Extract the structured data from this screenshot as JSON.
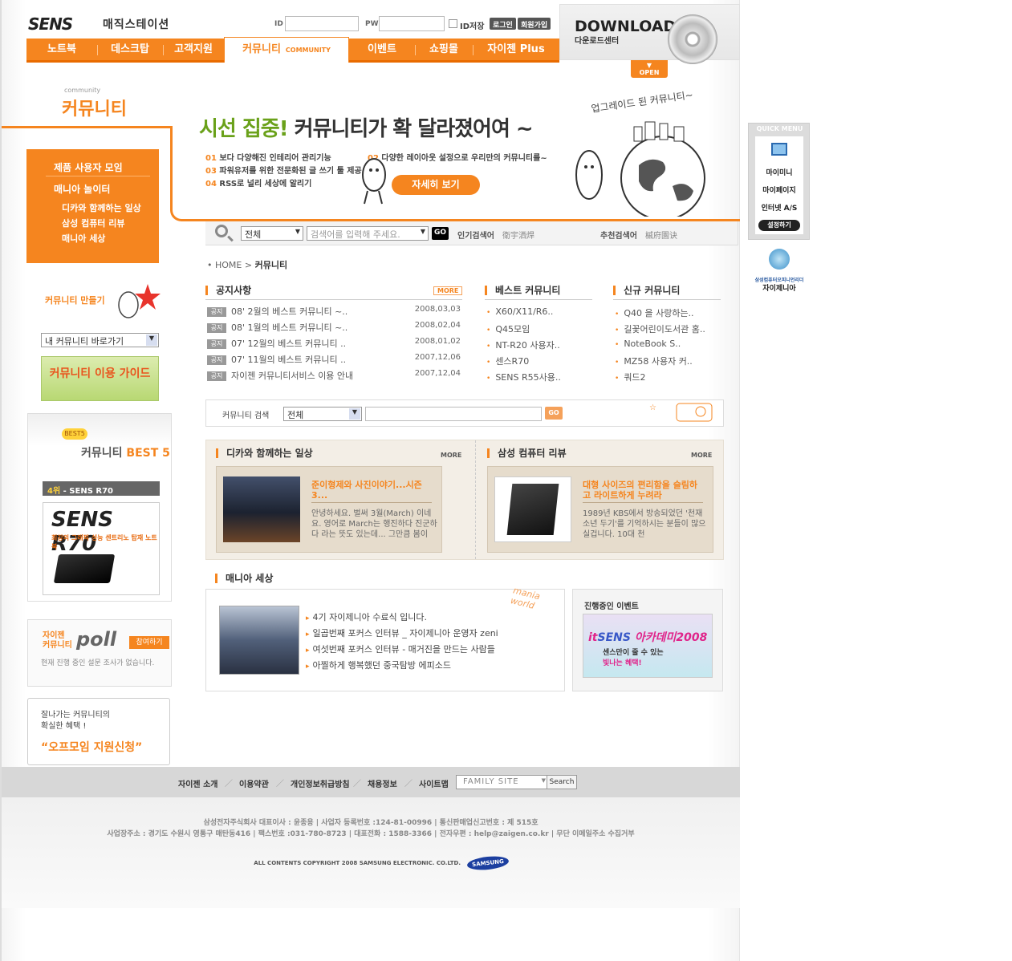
{
  "header": {
    "logo": "SENS",
    "slogan": "매직스테이션",
    "id_label": "ID",
    "pw_label": "PW",
    "id_save": "ID저장",
    "login": "로그인",
    "join": "회원가입"
  },
  "download": {
    "title": "DOWNLOAD",
    "subtitle": "다운로드센터",
    "open": "OPEN"
  },
  "nav": {
    "items": [
      "노트북",
      "데스크탑",
      "고객지원",
      "커뮤니티",
      "이벤트",
      "쇼핑몰",
      "자이젠 Plus"
    ],
    "active_sub": "COMMUNITY"
  },
  "section": {
    "small": "community",
    "title": "커뮤니티"
  },
  "banner": {
    "head_accent": "시선 집중!",
    "head_rest": " 커뮤니티가 확 달라졌어여 ~",
    "lines": [
      {
        "num": "01",
        "text": "보다 다양해진 인테리어 관리기능"
      },
      {
        "num": "02",
        "text": "다양한 레이아웃 설정으로 우리만의 커뮤니티를~"
      },
      {
        "num": "03",
        "text": "파워유저를 위한 전문화된 글 쓰기 툴 제공"
      },
      {
        "num": "04",
        "text": "RSS로 널리 세상에 알리기"
      }
    ],
    "button": "자세히 보기",
    "hand_text": "업그레이드 된 커뮤니티~"
  },
  "left_menu": {
    "main": [
      "제품 사용자 모임",
      "매니아 놀이터"
    ],
    "sub": [
      "디카와 함께하는 일상",
      "삼성 컴퓨터 리뷰",
      "매니아 세상"
    ]
  },
  "make": {
    "title": "커뮤니티 만들기",
    "select": "내 커뮤니티 바로가기",
    "guide": "커뮤니티 이용 가이드"
  },
  "best5": {
    "badge": "BEST5",
    "title_pre": "커뮤니티 ",
    "title_accent": "BEST 5",
    "rank": "4위",
    "rank_name": " - SENS R70",
    "product": "SENS R70",
    "desc": "최강의 그래픽 성능 센트리노 탑재 노트북"
  },
  "poll": {
    "label1": "자이젠",
    "label2": "커뮤니티",
    "logo": "poll",
    "btn": "참여하기",
    "msg": "현재 진행 중인 설문 조사가 없습니다."
  },
  "offmeet": {
    "line1": "잘나가는 커뮤니티의",
    "line2": "확실한 혜택 !",
    "cta": "“오프모임 지원신청”"
  },
  "search": {
    "select": "전체",
    "placeholder": "검색어를 입력해 주세요.",
    "go": "GO",
    "hot_label": "인기검색어",
    "hot_word": "衛宇洒焊",
    "rec_label": "추천검색어",
    "rec_word": "槭府園诀"
  },
  "breadcrumb": {
    "home": "HOME",
    "current": "커뮤니티"
  },
  "notice": {
    "title": "공지사항",
    "more": "MORE",
    "tag": "공지",
    "rows": [
      {
        "title": "08' 2월의 베스트 커뮤니티 ~..",
        "date": "2008,03,03"
      },
      {
        "title": "08' 1월의 베스트 커뮤니티 ~..",
        "date": "2008,02,04"
      },
      {
        "title": "07' 12월의 베스트 커뮤니티 ..",
        "date": "2008,01,02"
      },
      {
        "title": "07' 11월의 베스트 커뮤니티 ..",
        "date": "2007,12,06"
      },
      {
        "title": "자이젠 커뮤니티서비스 이용 안내",
        "date": "2007,12,04"
      }
    ]
  },
  "best_comm": {
    "title": "베스트 커뮤니티",
    "items": [
      "X60/X11/R6..",
      "Q45모임",
      "NT-R20 사용자..",
      "센스R70",
      "SENS R55사용.."
    ]
  },
  "new_comm": {
    "title": "신규 커뮤니티",
    "items": [
      "Q40 을 사랑하는..",
      "길꽃어린이도서관 홈..",
      "NoteBook S..",
      "MZ58 사용자 커..",
      "쿼드2"
    ]
  },
  "csearch": {
    "label": "커뮤니티 검색",
    "select": "전체",
    "go": "GO"
  },
  "daily": {
    "title": "디카와 함께하는 일상",
    "more": "MORE",
    "card_title": "준이형제와 사진이야기...시즌3...",
    "card_body": "안녕하세요. 벌써 3월(March) 이네요. 영어로 March는 행진하다 진군하다 라는 뜻도 있는데... 그만큼 봄이"
  },
  "review": {
    "title": "삼성 컴퓨터 리뷰",
    "more": "MORE",
    "card_title": "대형 사이즈의 편리함을 슬림하고 라이트하게 누려라",
    "card_body": "1989년 KBS에서 방송되었던 '천재소년 두기'를 기억하시는 분들이 많으실겁니다. 10대 천"
  },
  "mania": {
    "title": "매니아 세상",
    "items": [
      "4기 자이제니아 수료식 입니다.",
      "일곱번째 포커스 인터뷰 _ 자이제니아 운영자 zeni",
      "여섯번째 포커스 인터뷰 - 매거진을 만드는 사람들",
      "아찔하게 행복했던 중국탐방 에피소드"
    ],
    "deco": "mania world"
  },
  "event": {
    "title": "진행중인 이벤트",
    "brand": "SENS",
    "brand_it": "it",
    "name": "아카데미2008",
    "line1": "센스만이 줄 수 있는",
    "line2": "빛나는 혜택!"
  },
  "footer": {
    "links": [
      "자이젠 소개",
      "이용약관",
      "개인정보취급방침",
      "채용정보",
      "사이트맵"
    ],
    "family": "FAMILY SITE",
    "search": "Search",
    "info1": "삼성전자주식회사 대표이사 : 윤종용  |  사업자 등록번호 :124-81-00996  |  통신판매업신고번호 : 제 515호",
    "info2": "사업장주소 : 경기도 수원시 영통구 매탄동416  |  팩스번호 :031-780-8723  |  대표전화 : 1588-3366  |  전자우편 : help@zaigen.co.kr  |  무단 이메일주소 수집거부",
    "copyright": "ALL CONTENTS COPYRIGHT 2008 SAMSUNG ELECTRONIC. CO.LTD.",
    "samsung": "SAMSUNG"
  },
  "quick": {
    "title": "QUICK MENU",
    "items": [
      "마이미니",
      "마이페이지",
      "인터넷 A/S"
    ],
    "btn": "설정하기",
    "zai_small": "삼성컴퓨터오피니언리더",
    "zai": "자이제니아"
  },
  "colors": {
    "accent": "#f5851f",
    "green": "#6aa11a"
  }
}
